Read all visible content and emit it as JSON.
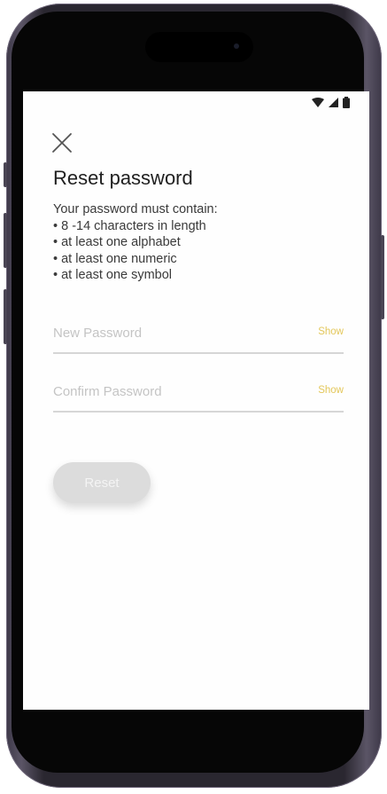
{
  "status_bar": {
    "icons": [
      "wifi-icon",
      "cellular-signal-icon",
      "battery-icon"
    ]
  },
  "close_icon": "close-icon",
  "title": "Reset password",
  "requirements": {
    "intro": "Your password must contain:",
    "items": [
      "• 8 -14 characters in length",
      "• at least one alphabet",
      "• at least one numeric",
      "• at least one symbol"
    ]
  },
  "new_password": {
    "placeholder": "New Password",
    "show_label": "Show"
  },
  "confirm_password": {
    "placeholder": "Confirm Password",
    "show_label": "Show"
  },
  "reset_button": {
    "label": "Reset"
  },
  "colors": {
    "accent": "#e3c75a",
    "disabled_button": "#dcdcdc"
  }
}
